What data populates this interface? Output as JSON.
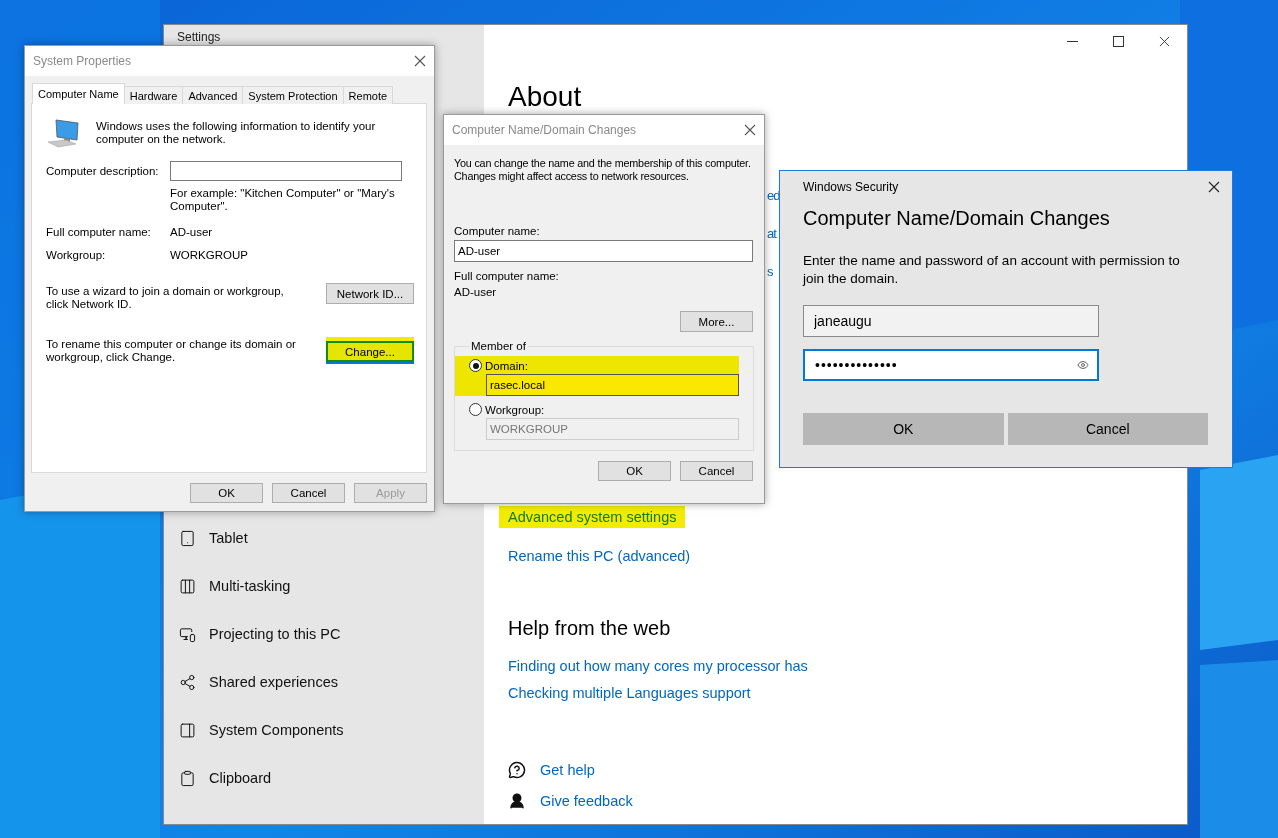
{
  "settings": {
    "title": "Settings",
    "sidebar": {
      "items": [
        {
          "label": "Tablet"
        },
        {
          "label": "Multi-tasking"
        },
        {
          "label": "Projecting to this PC"
        },
        {
          "label": "Shared experiences"
        },
        {
          "label": "System Components"
        },
        {
          "label": "Clipboard"
        }
      ]
    },
    "page_title": "About",
    "partial_links": [
      "ed",
      "at",
      "s"
    ],
    "links": [
      {
        "label": "Advanced system settings",
        "highlighted": true
      },
      {
        "label": "Rename this PC (advanced)",
        "highlighted": false
      }
    ],
    "help": {
      "heading": "Help from the web",
      "links": [
        "Finding out how many cores my processor has",
        "Checking multiple Languages support"
      ]
    },
    "support_links": [
      "Get help",
      "Give feedback"
    ]
  },
  "system_properties": {
    "title": "System Properties",
    "tabs": [
      {
        "label": "Computer Name",
        "selected": true
      },
      {
        "label": "Hardware",
        "selected": false
      },
      {
        "label": "Advanced",
        "selected": false
      },
      {
        "label": "System Protection",
        "selected": false
      },
      {
        "label": "Remote",
        "selected": false
      }
    ],
    "intro": "Windows uses the following information to identify your computer on the network.",
    "description_label": "Computer description:",
    "description_hint": "For example: \"Kitchen Computer\" or \"Mary's Computer\".",
    "full_name_label": "Full computer name:",
    "full_name": "AD-user",
    "workgroup_label": "Workgroup:",
    "workgroup": "WORKGROUP",
    "actions": [
      {
        "text": "To use a wizard to join a domain or workgroup, click Network ID.",
        "button": "Network ID...",
        "highlighted": false
      },
      {
        "text": "To rename this computer or change its domain or workgroup, click Change.",
        "button": "Change...",
        "highlighted": true
      }
    ],
    "buttons": [
      {
        "label": "OK",
        "disabled": false
      },
      {
        "label": "Cancel",
        "disabled": false
      },
      {
        "label": "Apply",
        "disabled": true
      }
    ]
  },
  "domain_changes": {
    "title": "Computer Name/Domain Changes",
    "intro": "You can change the name and the membership of this computer. Changes might affect access to network resources.",
    "computer_name_label": "Computer name:",
    "computer_name": "AD-user",
    "full_name_label": "Full computer name:",
    "full_name": "AD-user",
    "more_button": "More...",
    "member_of": {
      "legend": "Member of",
      "options": [
        {
          "label": "Domain:",
          "selected": true,
          "highlighted": true,
          "value": "rasec.local",
          "disabled": false
        },
        {
          "label": "Workgroup:",
          "selected": false,
          "highlighted": false,
          "value": "WORKGROUP",
          "disabled": true
        }
      ]
    },
    "buttons": [
      "OK",
      "Cancel"
    ]
  },
  "security": {
    "title": "Windows Security",
    "heading": "Computer Name/Domain Changes",
    "message": "Enter the name and password of an account with permission to join the domain.",
    "username": "janeaugu",
    "password": "••••••••••••••",
    "buttons": [
      "OK",
      "Cancel"
    ]
  }
}
